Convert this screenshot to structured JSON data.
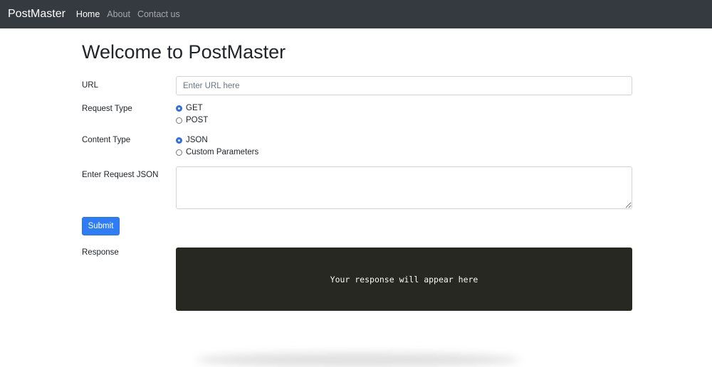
{
  "nav": {
    "brand": "PostMaster",
    "links": [
      {
        "label": "Home",
        "active": true
      },
      {
        "label": "About",
        "active": false
      },
      {
        "label": "Contact us",
        "active": false
      }
    ]
  },
  "page_title": "Welcome to PostMaster",
  "form": {
    "url": {
      "label": "URL",
      "value": "",
      "placeholder": "Enter URL here"
    },
    "request_type": {
      "label": "Request Type",
      "options": [
        {
          "label": "GET",
          "checked": true
        },
        {
          "label": "POST",
          "checked": false
        }
      ]
    },
    "content_type": {
      "label": "Content Type",
      "options": [
        {
          "label": "JSON",
          "checked": true
        },
        {
          "label": "Custom Parameters",
          "checked": false
        }
      ]
    },
    "request_json": {
      "label": "Enter Request JSON",
      "value": "",
      "placeholder": ""
    },
    "submit_label": "Submit"
  },
  "response": {
    "label": "Response",
    "text": "Your response will appear here"
  },
  "colors": {
    "navbar": "#343a40",
    "primary": "#2f7df6",
    "response_bg": "#272822",
    "response_text": "#f8f8f2"
  }
}
